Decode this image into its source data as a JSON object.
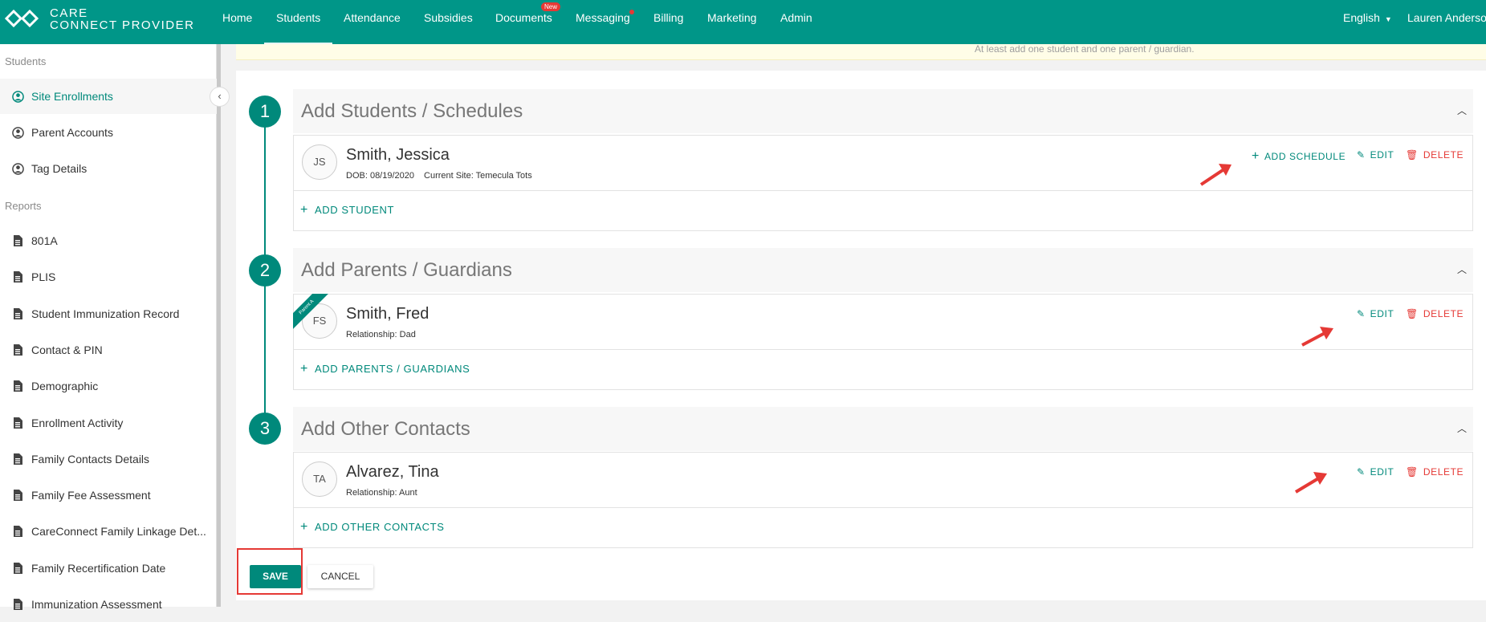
{
  "app": {
    "logo_line1": "CARE",
    "logo_line2": "CONNECT PROVIDER"
  },
  "nav": {
    "items": [
      {
        "label": "Home"
      },
      {
        "label": "Students"
      },
      {
        "label": "Attendance"
      },
      {
        "label": "Subsidies"
      },
      {
        "label": "Documents"
      },
      {
        "label": "Messaging"
      },
      {
        "label": "Billing"
      },
      {
        "label": "Marketing"
      },
      {
        "label": "Admin"
      }
    ],
    "documents_badge": "New",
    "language": "English",
    "user": "Lauren Anderson",
    "accent_color": "#009688"
  },
  "banner": {
    "text": "At least add one student and one parent / guardian."
  },
  "sidebar": {
    "students_heading": "Students",
    "students_items": [
      {
        "label": "Site Enrollments",
        "icon": "person-circle-icon"
      },
      {
        "label": "Parent Accounts",
        "icon": "person-circle-icon"
      },
      {
        "label": "Tag Details",
        "icon": "person-circle-icon"
      }
    ],
    "reports_heading": "Reports",
    "reports_items": [
      {
        "label": "801A"
      },
      {
        "label": "PLIS"
      },
      {
        "label": "Student Immunization Record"
      },
      {
        "label": "Contact & PIN"
      },
      {
        "label": "Demographic"
      },
      {
        "label": "Enrollment Activity"
      },
      {
        "label": "Family Contacts Details"
      },
      {
        "label": "Family Fee Assessment"
      },
      {
        "label": "CareConnect Family Linkage Det..."
      },
      {
        "label": "Family Recertification Date"
      },
      {
        "label": "Immunization Assessment"
      }
    ]
  },
  "sections": [
    {
      "number": "1",
      "title": "Add Students / Schedules",
      "person": {
        "initials": "JS",
        "name": "Smith, Jessica",
        "dob": "DOB: 08/19/2020",
        "site": "Current Site: Temecula Tots"
      },
      "actions": {
        "add_schedule": "ADD SCHEDULE",
        "edit": "EDIT",
        "delete": "DELETE"
      },
      "add_label": "ADD STUDENT"
    },
    {
      "number": "2",
      "title": "Add Parents / Guardians",
      "person": {
        "initials": "FS",
        "name": "Smith, Fred",
        "relationship": "Relationship: Dad",
        "ribbon": "Parent A"
      },
      "actions": {
        "edit": "EDIT",
        "delete": "DELETE"
      },
      "add_label": "ADD PARENTS / GUARDIANS"
    },
    {
      "number": "3",
      "title": "Add Other Contacts",
      "person": {
        "initials": "TA",
        "name": "Alvarez, Tina",
        "relationship": "Relationship: Aunt"
      },
      "actions": {
        "edit": "EDIT",
        "delete": "DELETE"
      },
      "add_label": "ADD OTHER CONTACTS"
    }
  ],
  "footer": {
    "save": "SAVE",
    "cancel": "CANCEL"
  }
}
